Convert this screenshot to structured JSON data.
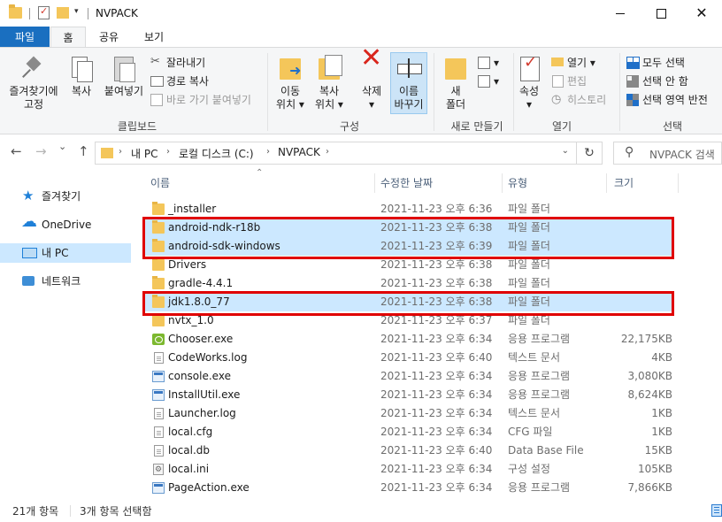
{
  "window": {
    "title": "NVPACK",
    "minimize": "",
    "maximize": "",
    "close": "✕",
    "qat_dropdown": "▾"
  },
  "ribbon": {
    "tabs": [
      {
        "label": "파일"
      },
      {
        "label": "홈"
      },
      {
        "label": "공유"
      },
      {
        "label": "보기"
      }
    ],
    "clipboard": {
      "pin_l1": "즐겨찾기에",
      "pin_l2": "고정",
      "copy": "복사",
      "paste": "붙여넣기",
      "cut": "잘라내기",
      "copy_path": "경로 복사",
      "paste_shortcut": "바로 가기 붙여넣기",
      "label": "클립보드"
    },
    "organize": {
      "move_l1": "이동",
      "move_l2": "위치 ▾",
      "copy_l1": "복사",
      "copy_l2": "위치 ▾",
      "delete_l1": "삭제",
      "delete_l2": "▾",
      "rename_l1": "이름",
      "rename_l2": "바꾸기",
      "label": "구성"
    },
    "new": {
      "new_folder_l1": "새",
      "new_folder_l2": "폴더",
      "new_item": "▾",
      "easy_access": "▾",
      "label": "새로 만들기"
    },
    "open": {
      "properties": "속성",
      "properties_drop": "▾",
      "open": "열기 ▾",
      "edit": "편집",
      "history": "히스토리",
      "label": "열기"
    },
    "select": {
      "select_all": "모두 선택",
      "select_none": "선택 안 함",
      "invert": "선택 영역 반전",
      "label": "선택"
    }
  },
  "nav": {
    "back": "←",
    "forward": "→",
    "recent": "⌄",
    "up": "↑",
    "crumbs": [
      "내 PC",
      "로컬 디스크 (C:)",
      "NVPACK"
    ],
    "crumb_sep": "›",
    "address_dropdown": "⌄",
    "refresh": "↻",
    "search_icon": "⚲",
    "search_placeholder": "NVPACK 검색"
  },
  "navpane": {
    "items": [
      {
        "label": "즐겨찾기"
      },
      {
        "label": "OneDrive"
      },
      {
        "label": "내 PC"
      },
      {
        "label": "네트워크"
      }
    ]
  },
  "columns": {
    "name": "이름",
    "date": "수정한 날짜",
    "type": "유형",
    "size": "크기",
    "sort_indicator": "⌃"
  },
  "files": [
    {
      "name": "_installer",
      "date": "2021-11-23 오후 6:36",
      "type": "파일 폴더",
      "size": "",
      "icon": "folder-icon"
    },
    {
      "name": "android-ndk-r18b",
      "date": "2021-11-23 오후 6:38",
      "type": "파일 폴더",
      "size": "",
      "icon": "folder-icon"
    },
    {
      "name": "android-sdk-windows",
      "date": "2021-11-23 오후 6:39",
      "type": "파일 폴더",
      "size": "",
      "icon": "folder-icon"
    },
    {
      "name": "Drivers",
      "date": "2021-11-23 오후 6:38",
      "type": "파일 폴더",
      "size": "",
      "icon": "folder-icon"
    },
    {
      "name": "gradle-4.4.1",
      "date": "2021-11-23 오후 6:38",
      "type": "파일 폴더",
      "size": "",
      "icon": "folder-icon"
    },
    {
      "name": "jdk1.8.0_77",
      "date": "2021-11-23 오후 6:38",
      "type": "파일 폴더",
      "size": "",
      "icon": "folder-icon"
    },
    {
      "name": "nvtx_1.0",
      "date": "2021-11-23 오후 6:37",
      "type": "파일 폴더",
      "size": "",
      "icon": "folder-icon"
    },
    {
      "name": "Chooser.exe",
      "date": "2021-11-23 오후 6:34",
      "type": "응용 프로그램",
      "size": "22,175KB",
      "icon": "chooser-app-icon"
    },
    {
      "name": "CodeWorks.log",
      "date": "2021-11-23 오후 6:40",
      "type": "텍스트 문서",
      "size": "4KB",
      "icon": "text-document-icon"
    },
    {
      "name": "console.exe",
      "date": "2021-11-23 오후 6:34",
      "type": "응용 프로그램",
      "size": "3,080KB",
      "icon": "application-icon"
    },
    {
      "name": "InstallUtil.exe",
      "date": "2021-11-23 오후 6:34",
      "type": "응용 프로그램",
      "size": "8,624KB",
      "icon": "application-icon"
    },
    {
      "name": "Launcher.log",
      "date": "2021-11-23 오후 6:34",
      "type": "텍스트 문서",
      "size": "1KB",
      "icon": "text-document-icon"
    },
    {
      "name": "local.cfg",
      "date": "2021-11-23 오후 6:34",
      "type": "CFG 파일",
      "size": "1KB",
      "icon": "file-icon"
    },
    {
      "name": "local.db",
      "date": "2021-11-23 오후 6:40",
      "type": "Data Base File",
      "size": "15KB",
      "icon": "file-icon"
    },
    {
      "name": "local.ini",
      "date": "2021-11-23 오후 6:34",
      "type": "구성 설정",
      "size": "105KB",
      "icon": "settings-file-icon"
    },
    {
      "name": "PageAction.exe",
      "date": "2021-11-23 오후 6:34",
      "type": "응용 프로그램",
      "size": "7,866KB",
      "icon": "application-icon"
    }
  ],
  "status": {
    "item_count": "21개 항목",
    "selected": "3개 항목 선택함"
  },
  "colors": {
    "file_tab": "#1a6fc0",
    "selection": "#cce8ff",
    "highlight_box": "#e00000",
    "folder": "#f4c65a"
  }
}
